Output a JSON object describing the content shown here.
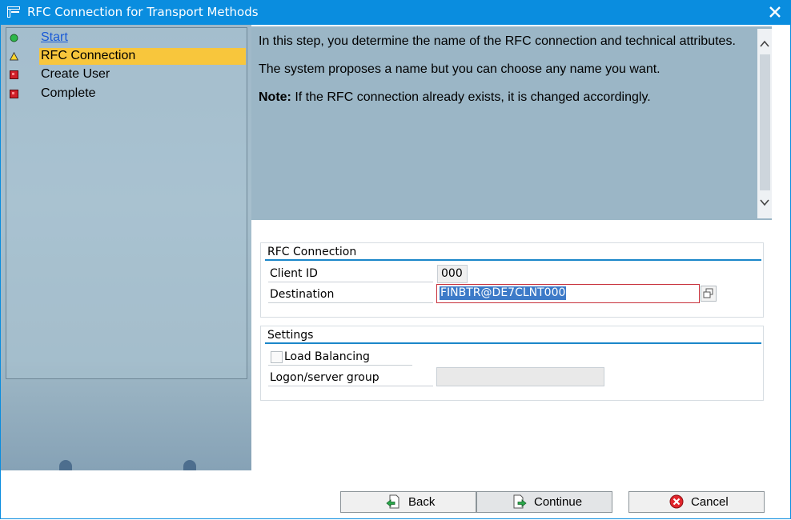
{
  "window": {
    "title": "RFC Connection for Transport Methods"
  },
  "nav": {
    "items": [
      {
        "label": "Start",
        "status": "green",
        "link": true
      },
      {
        "label": "RFC Connection",
        "status": "warning",
        "active": true
      },
      {
        "label": "Create User",
        "status": "red"
      },
      {
        "label": "Complete",
        "status": "red"
      }
    ]
  },
  "info": {
    "p1": "In this step, you determine the name of the RFC connection and technical attributes.",
    "p2": "The system proposes a name but you can choose any name you want.",
    "note_label": "Note:",
    "note_text": " If the RFC connection already exists, it is changed accordingly."
  },
  "rfc_group": {
    "title": "RFC Connection",
    "client_id_label": "Client ID",
    "client_id_value": "000",
    "destination_label": "Destination",
    "destination_value": "FINBTR@DE7CLNT000"
  },
  "settings_group": {
    "title": "Settings",
    "load_balancing_label": "Load Balancing",
    "load_balancing_checked": false,
    "logon_group_label": "Logon/server group",
    "logon_group_value": ""
  },
  "buttons": {
    "back": "Back",
    "continue": "Continue",
    "cancel": "Cancel"
  },
  "colors": {
    "titlebar": "#0a8ddf",
    "highlight": "#f8c63c",
    "pane": "#9bb6c6"
  }
}
